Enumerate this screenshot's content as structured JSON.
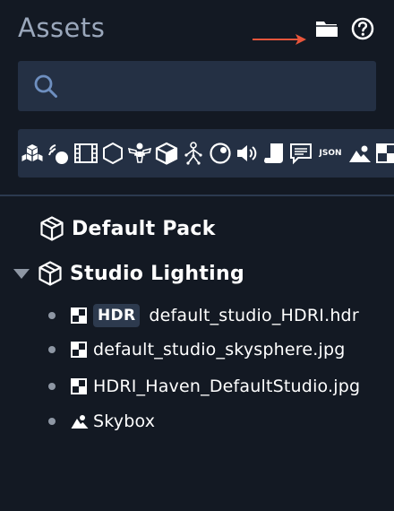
{
  "header": {
    "title": "Assets",
    "folder_icon": "folder-icon",
    "help_icon": "help-circle-icon",
    "annotation_arrow_color": "#e8553b"
  },
  "search": {
    "placeholder": "",
    "value": "",
    "icon": "search-icon"
  },
  "filters": {
    "json_label": "JSON",
    "items": [
      "cubes-icon",
      "light-icon",
      "film-icon",
      "hexagon-icon",
      "bone-figure-icon",
      "box-icon",
      "skeleton-icon",
      "sphere-icon",
      "speaker-icon",
      "script-icon",
      "text-icon",
      "json-icon",
      "image-icon",
      "texture-icon"
    ]
  },
  "tree": {
    "packs": [
      {
        "name": "Default Pack",
        "expanded": false
      },
      {
        "name": "Studio Lighting",
        "expanded": true,
        "assets": [
          {
            "badge": "HDR",
            "name": "default_studio_HDRI.hdr",
            "icon": "texture-icon"
          },
          {
            "badge": "",
            "name": "default_studio_skysphere.jpg",
            "icon": "texture-icon"
          },
          {
            "badge": "",
            "name": "HDRI_Haven_DefaultStudio.jpg",
            "icon": "texture-icon"
          },
          {
            "badge": "",
            "name": "Skybox",
            "icon": "skybox-icon"
          }
        ]
      }
    ]
  },
  "colors": {
    "background": "#131923",
    "surface": "#243044",
    "title": "#9aa7bb",
    "text": "#ffffff",
    "arrow": "#e8553b"
  }
}
